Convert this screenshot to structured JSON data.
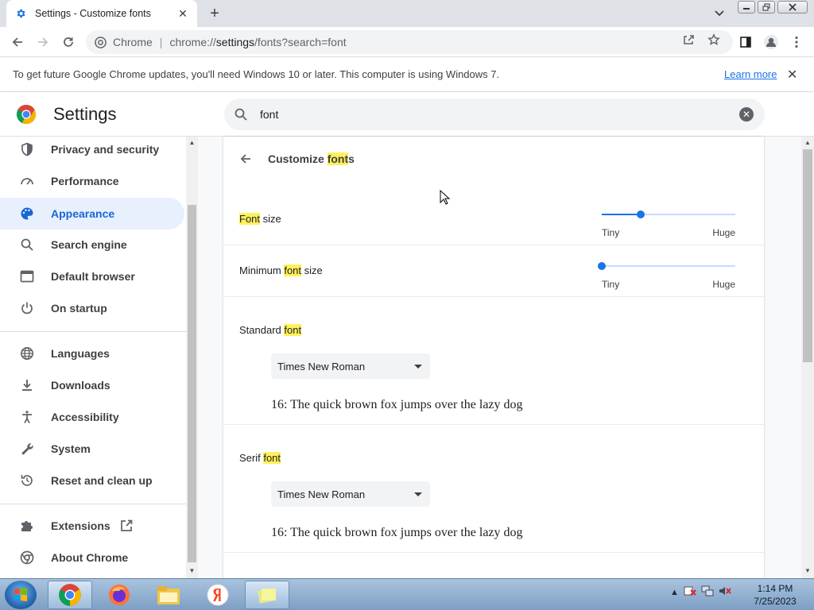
{
  "window": {
    "tab_title": "Settings - Customize fonts",
    "new_tab": "+",
    "tab_close": "✕"
  },
  "toolbar": {
    "omnibox_chip": "Chrome",
    "omnibox_sep": "|",
    "url_scheme": "chrome://",
    "url_host": "settings",
    "url_path": "/fonts?search=font"
  },
  "infobar": {
    "message": "To get future Google Chrome updates, you'll need Windows 10 or later. This computer is using Windows 7.",
    "learn_more": "Learn more",
    "close": "✕"
  },
  "header": {
    "title": "Settings",
    "search_value": "font",
    "clear": "✕"
  },
  "sidebar": {
    "items": [
      {
        "label": "Privacy and security",
        "icon": "shield-icon"
      },
      {
        "label": "Performance",
        "icon": "speedometer-icon"
      },
      {
        "label": "Appearance",
        "icon": "palette-icon",
        "active": true
      },
      {
        "label": "Search engine",
        "icon": "search-icon"
      },
      {
        "label": "Default browser",
        "icon": "browser-window-icon"
      },
      {
        "label": "On startup",
        "icon": "power-icon"
      },
      {
        "label": "Languages",
        "icon": "globe-icon"
      },
      {
        "label": "Downloads",
        "icon": "download-icon"
      },
      {
        "label": "Accessibility",
        "icon": "accessibility-icon"
      },
      {
        "label": "System",
        "icon": "wrench-icon"
      },
      {
        "label": "Reset and clean up",
        "icon": "restore-icon"
      },
      {
        "label": "Extensions",
        "icon": "puzzle-icon"
      },
      {
        "label": "About Chrome",
        "icon": "chrome-logo-icon"
      }
    ]
  },
  "page": {
    "title_pre": "Customize ",
    "title_hl": "font",
    "title_post": "s",
    "font_size": {
      "label_hl": "Font",
      "label_post": " size",
      "min_label": "Tiny",
      "max_label": "Huge",
      "value_fraction": 0.29
    },
    "min_font_size": {
      "label_pre": "Minimum ",
      "label_hl": "font",
      "label_post": " size",
      "min_label": "Tiny",
      "max_label": "Huge",
      "value_fraction": 0.0
    },
    "standard_font": {
      "label_pre": "Standard ",
      "label_hl": "font",
      "selected": "Times New Roman",
      "sample": "16: The quick brown fox jumps over the lazy dog"
    },
    "serif_font": {
      "label_pre": "Serif ",
      "label_hl": "font",
      "selected": "Times New Roman",
      "sample": "16: The quick brown fox jumps over the lazy dog"
    }
  },
  "taskbar": {
    "time": "1:14 PM",
    "date": "7/25/2023"
  },
  "colors": {
    "accent": "#1a73e8",
    "highlight": "#fff15b",
    "active_nav_bg": "#e8f0fe"
  }
}
